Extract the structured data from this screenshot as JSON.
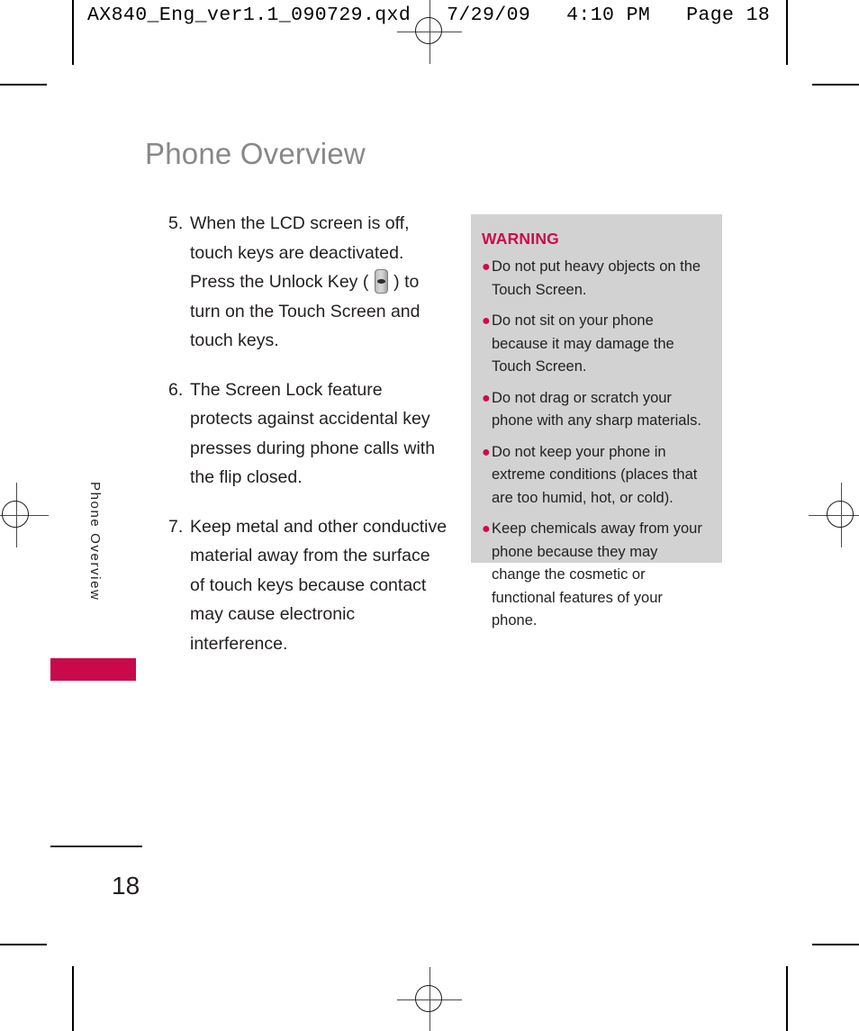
{
  "print_header": {
    "text": "AX840_Eng_ver1.1_090729.qxd   7/29/09   4:10 PM   Page 18"
  },
  "page": {
    "title": "Phone Overview",
    "number": "18",
    "side_tab_label": "Phone Overview",
    "accent_color": "#c80a4b",
    "title_color": "#888888"
  },
  "instructions": [
    {
      "number": "5.",
      "text_before_icon": "When the LCD screen is off, touch keys are deactivated. Press the Unlock Key ( ",
      "icon": "unlock-key-icon",
      "text_after_icon": " ) to turn on the Touch Screen and touch keys."
    },
    {
      "number": "6.",
      "text_before_icon": "The Screen Lock feature protects against accidental key presses during phone calls with the flip closed.",
      "icon": null,
      "text_after_icon": ""
    },
    {
      "number": "7.",
      "text_before_icon": "Keep metal and other conductive material away from the surface of touch keys because contact may cause electronic interference.",
      "icon": null,
      "text_after_icon": ""
    }
  ],
  "warning": {
    "title": "WARNING",
    "title_color": "#cc0a4c",
    "background_color": "#d2d2d2",
    "bullet": "●",
    "items": [
      "Do not put heavy objects on the Touch Screen.",
      "Do not sit on your phone because it may damage the Touch Screen.",
      "Do not drag or scratch your phone with any sharp materials.",
      "Do not keep your phone in extreme conditions (places that are too humid, hot, or cold).",
      "Keep chemicals away from your phone because they may change the cosmetic or functional features of your phone."
    ]
  }
}
